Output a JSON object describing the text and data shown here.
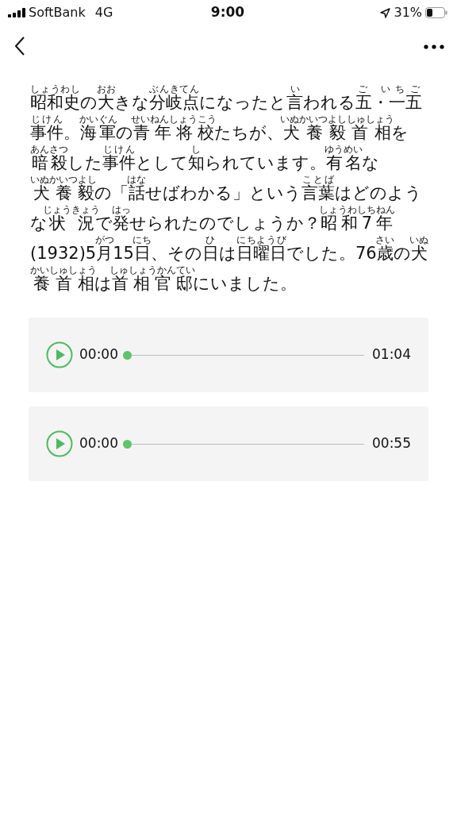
{
  "status_bar": {
    "carrier": "SoftBank",
    "network": "4G",
    "time": "9:00",
    "battery": "31%"
  },
  "article": [
    {
      "text": "昭和史",
      "ruby": "しょうわし"
    },
    {
      "text": "の"
    },
    {
      "text": "大",
      "ruby": "おお"
    },
    {
      "text": "きな"
    },
    {
      "text": "分岐点",
      "ruby": "ぶんきてん"
    },
    {
      "text": "になったと"
    },
    {
      "text": "言",
      "ruby": "い"
    },
    {
      "text": "われる"
    },
    {
      "text": "五・一五",
      "ruby": "ご いちご"
    },
    {
      "text": "事件",
      "ruby": "じけん"
    },
    {
      "text": "。"
    },
    {
      "text": "海軍",
      "ruby": "かいぐん"
    },
    {
      "text": "の"
    },
    {
      "text": "青年将校",
      "ruby": "せいねんしょうこう"
    },
    {
      "text": "たちが、"
    },
    {
      "text": "犬養毅首相",
      "ruby": "いぬかいつよししゅしょう"
    },
    {
      "text": "を"
    },
    {
      "text": "暗殺",
      "ruby": "あんさつ"
    },
    {
      "text": "した"
    },
    {
      "text": "事件",
      "ruby": "じけん"
    },
    {
      "text": "として"
    },
    {
      "text": "知",
      "ruby": "し"
    },
    {
      "text": "られています。"
    },
    {
      "text": "有名",
      "ruby": "ゆうめい"
    },
    {
      "text": "な"
    },
    {
      "text": "犬養毅",
      "ruby": "いぬかいつよし"
    },
    {
      "text": "の「"
    },
    {
      "text": "話",
      "ruby": "はな"
    },
    {
      "text": "せばわかる」という"
    },
    {
      "text": "言葉",
      "ruby": "ことば"
    },
    {
      "text": "はどのような"
    },
    {
      "text": "状況",
      "ruby": "じょうきょう"
    },
    {
      "text": "で"
    },
    {
      "text": "発",
      "ruby": "はっ"
    },
    {
      "text": "せられたのでしょうか？"
    },
    {
      "text": "昭和7年",
      "ruby": "しょうわしちねん"
    },
    {
      "text": "(1932)5"
    },
    {
      "text": "月",
      "ruby": "がつ"
    },
    {
      "text": "15"
    },
    {
      "text": "日",
      "ruby": "にち"
    },
    {
      "text": "、その"
    },
    {
      "text": "日",
      "ruby": "ひ"
    },
    {
      "text": "は"
    },
    {
      "text": "日曜日",
      "ruby": "にちようび"
    },
    {
      "text": "でした。76"
    },
    {
      "text": "歳",
      "ruby": "さい"
    },
    {
      "text": "の"
    },
    {
      "text": "犬養首相",
      "ruby": "いぬかいしゅしょう"
    },
    {
      "text": "は"
    },
    {
      "text": "首相官邸",
      "ruby": "しゅしょうかんてい"
    },
    {
      "text": "にいました。"
    }
  ],
  "players": [
    {
      "current": "00:00",
      "total": "01:04",
      "level": 0
    },
    {
      "current": "00:00",
      "total": "00:55",
      "level": 0
    }
  ]
}
